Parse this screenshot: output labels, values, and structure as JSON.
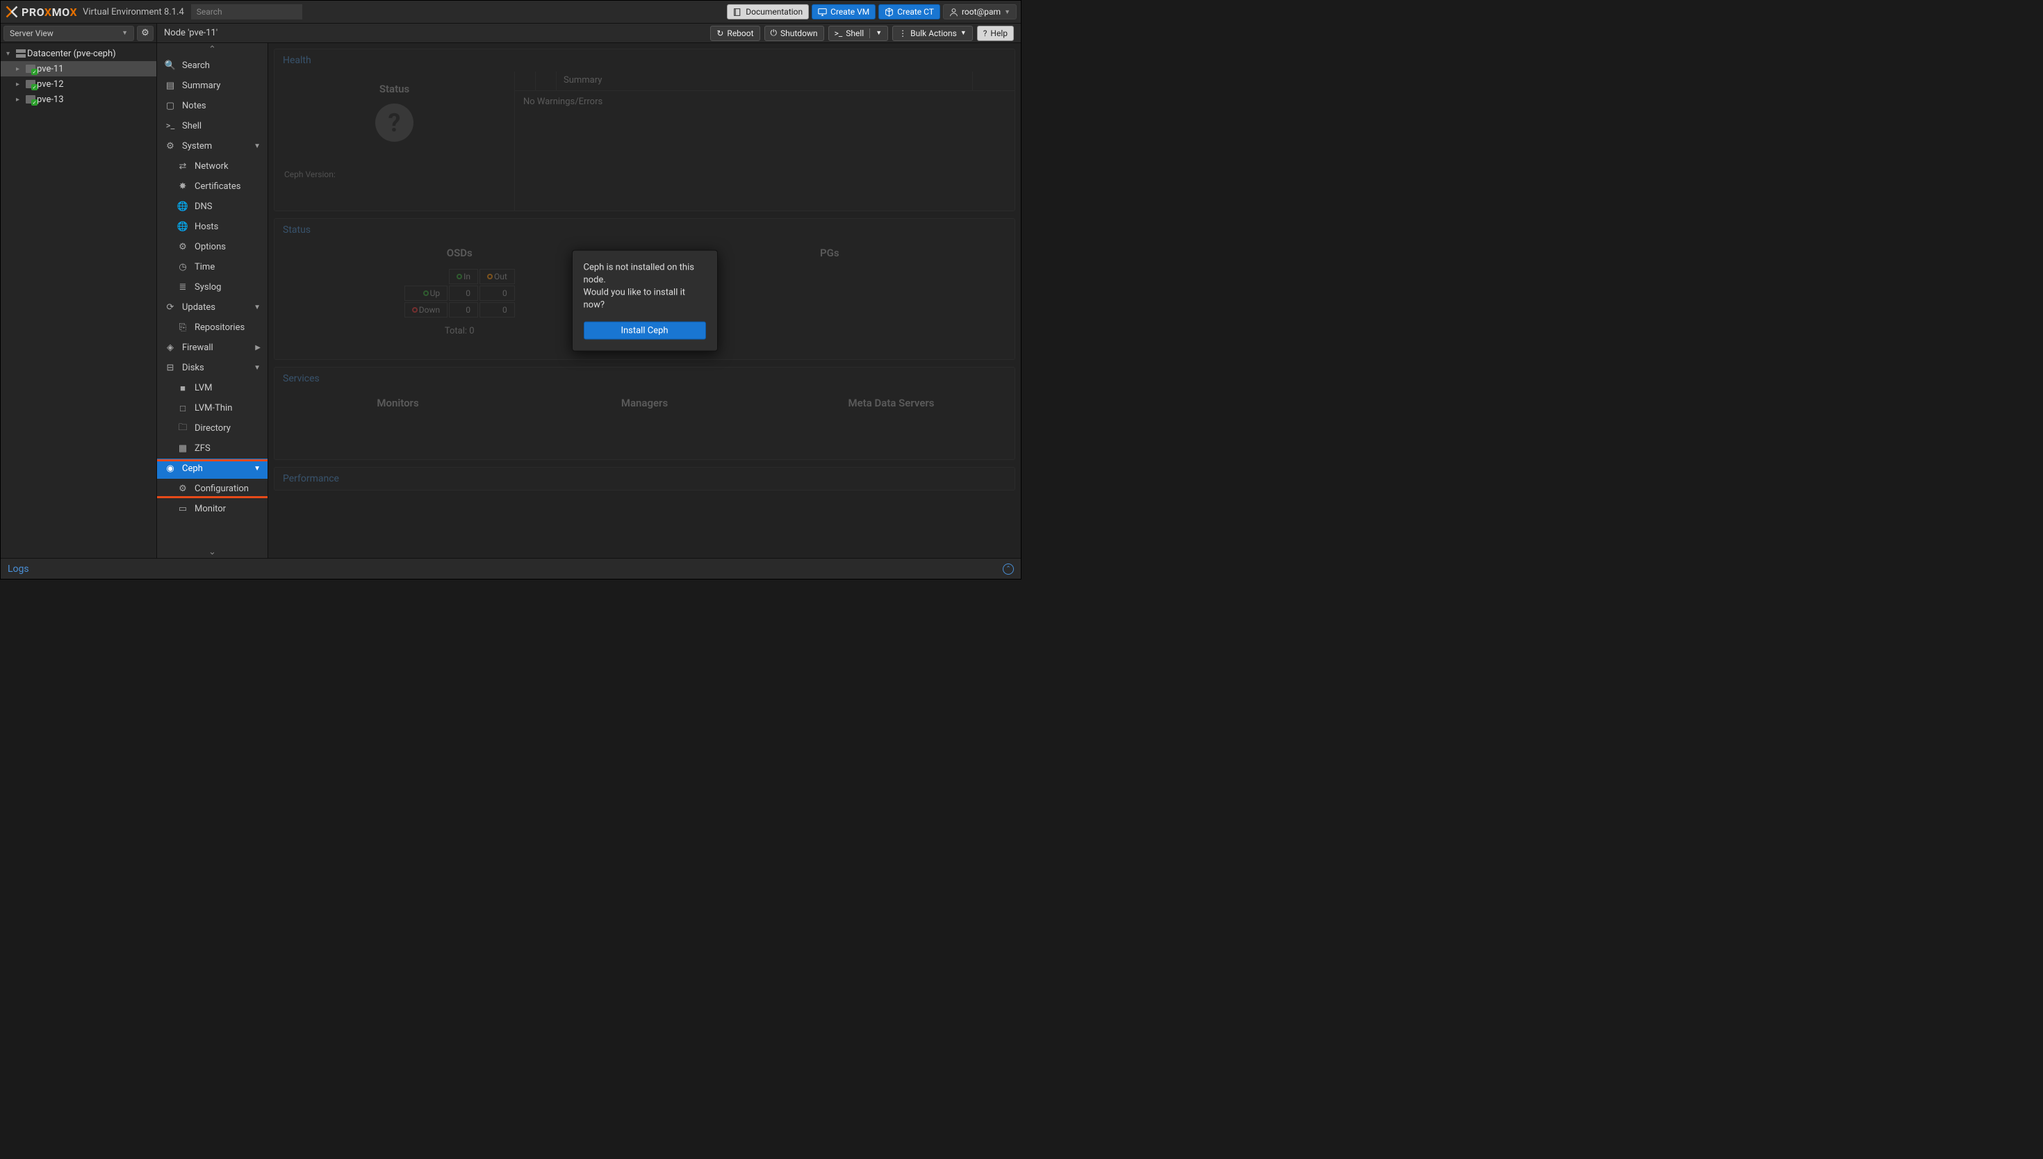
{
  "brand_pre": "PRO",
  "brand_mid": "X",
  "brand_post": "MO",
  "brand_end": "X",
  "ve_label": "Virtual Environment 8.1.4",
  "search_placeholder": "Search",
  "top_buttons": {
    "docs": "Documentation",
    "create_vm": "Create VM",
    "create_ct": "Create CT",
    "user": "root@pam"
  },
  "server_view": "Server View",
  "tree": {
    "datacenter": "Datacenter (pve-ceph)",
    "nodes": [
      "pve-11",
      "pve-12",
      "pve-13"
    ]
  },
  "crumb": "Node 'pve-11'",
  "actions": {
    "reboot": "Reboot",
    "shutdown": "Shutdown",
    "shell": "Shell",
    "bulk": "Bulk Actions",
    "help": "Help"
  },
  "menu": {
    "search": "Search",
    "summary": "Summary",
    "notes": "Notes",
    "shell": "Shell",
    "system": "System",
    "network": "Network",
    "certificates": "Certificates",
    "dns": "DNS",
    "hosts": "Hosts",
    "options": "Options",
    "time": "Time",
    "syslog": "Syslog",
    "updates": "Updates",
    "repositories": "Repositories",
    "firewall": "Firewall",
    "disks": "Disks",
    "lvm": "LVM",
    "lvm_thin": "LVM-Thin",
    "directory": "Directory",
    "zfs": "ZFS",
    "ceph": "Ceph",
    "configuration": "Configuration",
    "monitor": "Monitor"
  },
  "panels": {
    "health": {
      "title": "Health",
      "status_label": "Status",
      "ceph_version": "Ceph Version:",
      "summary_header": "Summary",
      "no_warnings": "No Warnings/Errors"
    },
    "status": {
      "title": "Status",
      "osds": "OSDs",
      "pgs": "PGs",
      "in": "In",
      "out": "Out",
      "up": "Up",
      "down": "Down",
      "total": "Total: 0",
      "zero": "0"
    },
    "services": {
      "title": "Services",
      "monitors": "Monitors",
      "managers": "Managers",
      "mds": "Meta Data Servers"
    },
    "performance": {
      "title": "Performance"
    }
  },
  "modal": {
    "line1": "Ceph is not installed on this node.",
    "line2": "Would you like to install it now?",
    "button": "Install Ceph"
  },
  "logs": "Logs"
}
